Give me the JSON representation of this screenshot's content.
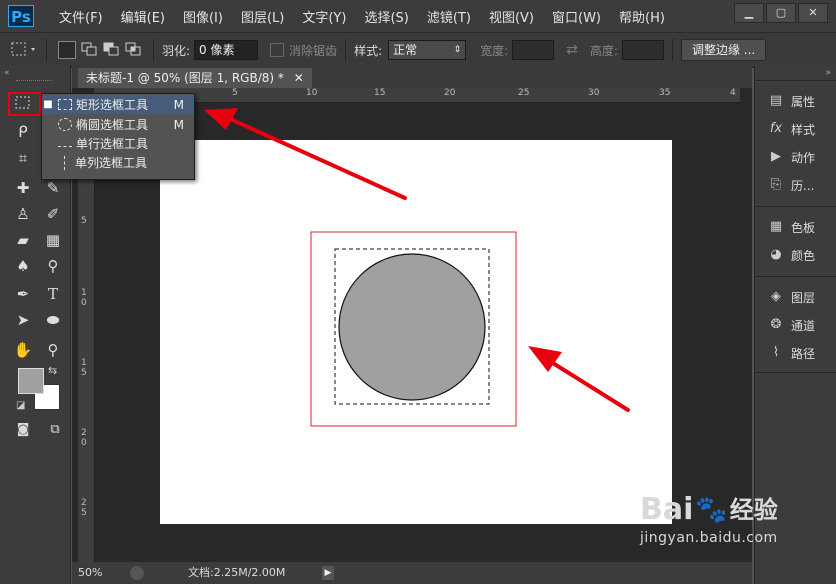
{
  "app": {
    "logo": "Ps"
  },
  "menu": [
    "文件(F)",
    "编辑(E)",
    "图像(I)",
    "图层(L)",
    "文字(Y)",
    "选择(S)",
    "滤镜(T)",
    "视图(V)",
    "窗口(W)",
    "帮助(H)"
  ],
  "options": {
    "feather_label": "羽化:",
    "feather_value": "0 像素",
    "antialias_label": "消除锯齿",
    "style_label": "样式:",
    "style_value": "正常",
    "width_label": "宽度:",
    "height_label": "高度:",
    "refine_button": "调整边缘 ..."
  },
  "document": {
    "tab_title": "未标题-1 @ 50% (图层 1, RGB/8) *",
    "ruler_h": [
      "0",
      "5",
      "10",
      "15",
      "20",
      "25",
      "30",
      "35",
      "4"
    ],
    "ruler_v": [
      "5",
      "1 0",
      "1 5",
      "2 0",
      "2 5"
    ]
  },
  "flyout": [
    {
      "label": "矩形选框工具",
      "key": "M",
      "active": true
    },
    {
      "label": "椭圆选框工具",
      "key": "M",
      "active": false
    },
    {
      "label": "单行选框工具",
      "key": "",
      "active": false
    },
    {
      "label": "单列选框工具",
      "key": "",
      "active": false
    }
  ],
  "status": {
    "zoom": "50%",
    "doc_info": "文档:2.25M/2.00M"
  },
  "panels": [
    {
      "label": "属性",
      "icon": "properties-icon"
    },
    {
      "label": "样式",
      "icon": "styles-icon"
    },
    {
      "label": "动作",
      "icon": "actions-icon"
    },
    {
      "label": "历...",
      "icon": "history-icon"
    },
    {
      "label": "色板",
      "icon": "swatches-icon"
    },
    {
      "label": "颜色",
      "icon": "color-icon"
    },
    {
      "label": "图层",
      "icon": "layers-icon"
    },
    {
      "label": "通道",
      "icon": "channels-icon"
    },
    {
      "label": "路径",
      "icon": "paths-icon"
    }
  ],
  "colors": {
    "foreground": "#a0a0a0",
    "background": "#ffffff",
    "circle": "#a0a0a0",
    "annotation": "#e8000e"
  },
  "watermark": {
    "brand": "Bai",
    "brand_tail": "经验",
    "url": "jingyan.baidu.com"
  }
}
